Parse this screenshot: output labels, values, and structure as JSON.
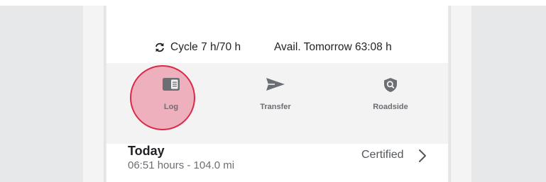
{
  "hos": {
    "cycle": "Cycle 7 h/70 h",
    "available": "Avail. Tomorrow 63:08 h",
    "cycle_icon": "refresh-icon"
  },
  "actions": [
    {
      "label": "Log",
      "icon": "logbook-icon",
      "highlighted": true
    },
    {
      "label": "Transfer",
      "icon": "send-icon"
    },
    {
      "label": "Roadside",
      "icon": "shield-search-icon"
    }
  ],
  "today": {
    "title": "Today",
    "summary": "06:51 hours - 104.0 mi",
    "status": "Certified"
  },
  "colors": {
    "highlight_fill": "#ea607a",
    "highlight_border": "#dc2849",
    "icon_gray": "#6b6e72",
    "action_bar_bg": "#f3f3f4"
  }
}
